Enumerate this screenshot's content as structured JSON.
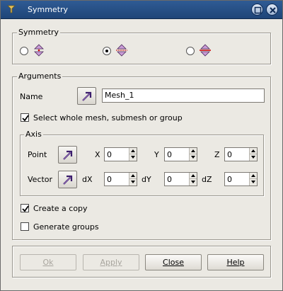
{
  "window": {
    "title": "Symmetry",
    "controls": [
      "minimize-icon",
      "close-icon"
    ]
  },
  "symmetry_group": {
    "label": "Symmetry",
    "options": [
      {
        "icon": "point-symmetry-icon",
        "selected": false
      },
      {
        "icon": "axis-symmetry-icon",
        "selected": true
      },
      {
        "icon": "plane-symmetry-icon",
        "selected": false
      }
    ]
  },
  "arguments_group": {
    "label": "Arguments",
    "name_label": "Name",
    "name_value": "Mesh_1",
    "select_whole_mesh": {
      "label": "Select whole mesh, submesh or group",
      "checked": true
    },
    "axis_group": {
      "label": "Axis",
      "point": {
        "label": "Point",
        "fields": [
          {
            "label": "X",
            "value": "0"
          },
          {
            "label": "Y",
            "value": "0"
          },
          {
            "label": "Z",
            "value": "0"
          }
        ]
      },
      "vector": {
        "label": "Vector",
        "fields": [
          {
            "label": "dX",
            "value": "0"
          },
          {
            "label": "dY",
            "value": "0"
          },
          {
            "label": "dZ",
            "value": "0"
          }
        ]
      }
    },
    "create_copy": {
      "label": "Create a copy",
      "checked": true
    },
    "generate_groups": {
      "label": "Generate groups",
      "checked": false
    }
  },
  "buttons": {
    "ok": {
      "label": "Ok",
      "enabled": false
    },
    "apply": {
      "label": "Apply",
      "enabled": false
    },
    "close": {
      "label": "Close",
      "enabled": true
    },
    "help": {
      "label": "Help",
      "enabled": true
    }
  }
}
